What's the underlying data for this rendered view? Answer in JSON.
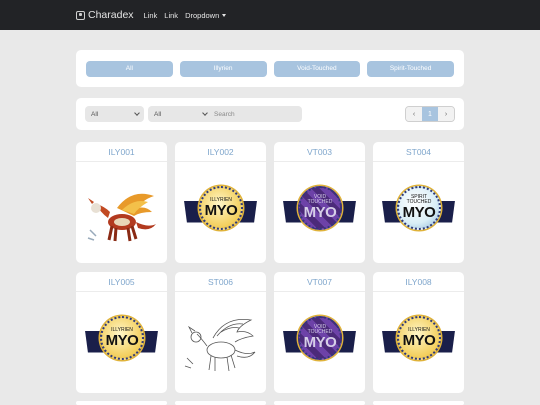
{
  "navbar": {
    "brand": "Charadex",
    "links": [
      "Link",
      "Link"
    ],
    "dropdown": "Dropdown"
  },
  "filters": [
    "All",
    "Illyrien",
    "Void-Touched",
    "Spirit-Touched"
  ],
  "search": {
    "select1": "All",
    "select2": "All",
    "placeholder": "Search"
  },
  "pagination": {
    "prev": "‹",
    "page": "1",
    "next": "›"
  },
  "cards": [
    {
      "code": "ILY001",
      "image": "creature-art"
    },
    {
      "code": "ILY002",
      "image": "myo-badge",
      "badge_top": "ILLYRIEN",
      "badge_main": "MYO"
    },
    {
      "code": "VT003",
      "image": "myo-badge",
      "badge_top": "VOID",
      "badge_sub": "TOUCHED",
      "badge_main": "MYO"
    },
    {
      "code": "ST004",
      "image": "myo-badge",
      "badge_top": "SPIRIT",
      "badge_sub": "TOUCHED",
      "badge_main": "MYO"
    },
    {
      "code": "ILY005",
      "image": "myo-badge",
      "badge_top": "ILLYRIEN",
      "badge_main": "MYO"
    },
    {
      "code": "ST006",
      "image": "creature-sketch"
    },
    {
      "code": "VT007",
      "image": "myo-badge",
      "badge_top": "VOID",
      "badge_sub": "TOUCHED",
      "badge_main": "MYO"
    },
    {
      "code": "ILY008",
      "image": "myo-badge",
      "badge_top": "ILLYRIEN",
      "badge_main": "MYO"
    }
  ],
  "colors": {
    "navbar": "#222326",
    "accent": "#a8c4df",
    "card_code": "#7fa6cc",
    "background": "#e9e9e9"
  }
}
